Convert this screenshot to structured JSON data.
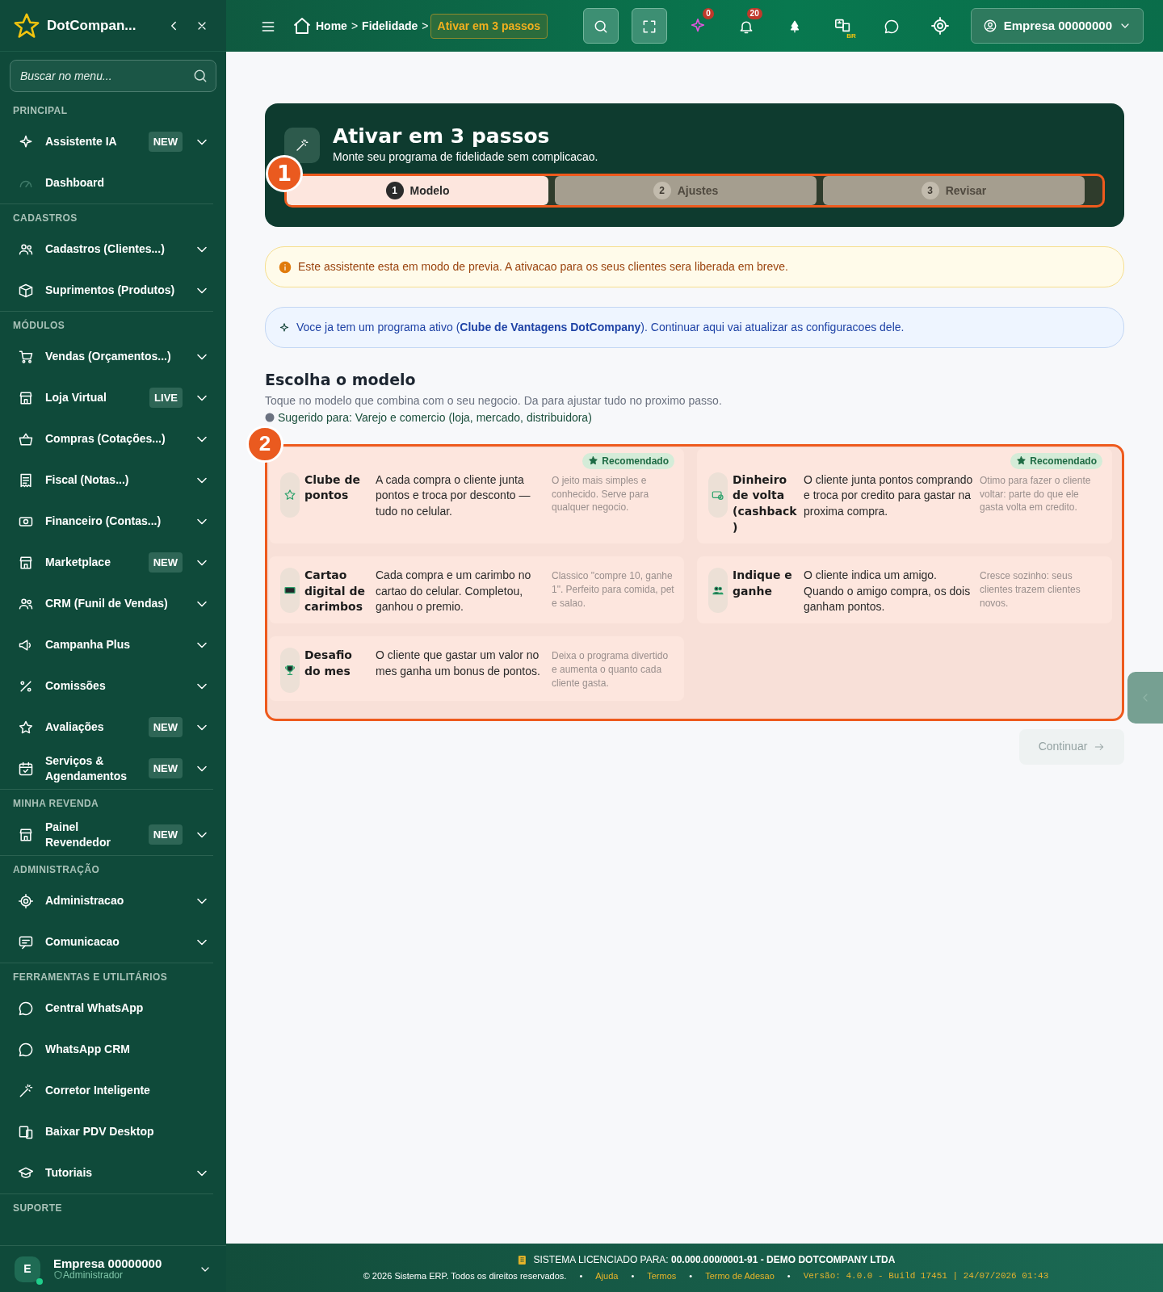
{
  "sidebar": {
    "brand": "DotCompan...",
    "search": {
      "placeholder": "Buscar no menu..."
    },
    "sections": [
      {
        "title": "PRINCIPAL",
        "items": [
          {
            "label": "Assistente IA",
            "badge": "NEW",
            "expandable": true
          },
          {
            "label": "Dashboard",
            "expandable": false
          }
        ]
      },
      {
        "title": "CADASTROS",
        "items": [
          {
            "label": "Cadastros (Clientes...)",
            "expandable": true
          },
          {
            "label": "Suprimentos (Produtos)",
            "expandable": true
          }
        ]
      },
      {
        "title": "MÓDULOS",
        "items": [
          {
            "label": "Vendas (Orçamentos...)",
            "expandable": true
          },
          {
            "label": "Loja Virtual",
            "badge": "LIVE",
            "expandable": true
          },
          {
            "label": "Compras (Cotações...)",
            "expandable": true
          },
          {
            "label": "Fiscal (Notas...)",
            "expandable": true
          },
          {
            "label": "Financeiro (Contas...)",
            "expandable": true
          },
          {
            "label": "Marketplace",
            "badge": "NEW",
            "expandable": true
          },
          {
            "label": "CRM (Funil de Vendas)",
            "expandable": true
          },
          {
            "label": "Campanha Plus",
            "expandable": true
          },
          {
            "label": "Comissões",
            "expandable": true
          },
          {
            "label": "Avaliações",
            "badge": "NEW",
            "expandable": true
          },
          {
            "label": "Serviços & Agendamentos",
            "badge": "NEW",
            "expandable": true
          }
        ]
      },
      {
        "title": "MINHA REVENDA",
        "items": [
          {
            "label": "Painel Revendedor",
            "badge": "NEW",
            "expandable": true
          }
        ]
      },
      {
        "title": "ADMINISTRAÇÃO",
        "items": [
          {
            "label": "Administracao",
            "expandable": true
          },
          {
            "label": "Comunicacao",
            "expandable": true
          }
        ]
      },
      {
        "title": "FERRAMENTAS E UTILITÁRIOS",
        "items": [
          {
            "label": "Central WhatsApp",
            "expandable": false
          },
          {
            "label": "WhatsApp CRM",
            "expandable": false
          },
          {
            "label": "Corretor Inteligente",
            "expandable": false
          },
          {
            "label": "Baixar PDV Desktop",
            "expandable": false
          },
          {
            "label": "Tutoriais",
            "expandable": true
          }
        ]
      },
      {
        "title": "SUPORTE"
      }
    ],
    "user": {
      "initial": "E",
      "name": "Empresa 00000000",
      "role": "Administrador",
      "online": true
    }
  },
  "topbar": {
    "separator": ">",
    "breadcrumb": [
      {
        "label": "Home",
        "current": false
      },
      {
        "label": "Fidelidade",
        "current": false
      },
      {
        "label": "Ativar em 3 passos",
        "current": true
      }
    ],
    "sparkle_badge": "0",
    "bell_badge": "20",
    "language": "BR",
    "account": "Empresa 00000000"
  },
  "wizard": {
    "title": "Ativar em 3 passos",
    "subtitle": "Monte seu programa de fidelidade sem complicacao.",
    "steps": [
      {
        "number": "1",
        "label": "Modelo",
        "selected": true
      },
      {
        "number": "2",
        "label": "Ajustes",
        "selected": false
      },
      {
        "number": "3",
        "label": "Revisar",
        "selected": false
      }
    ]
  },
  "alerts": [
    {
      "kind": "warning",
      "text": "Este assistente esta em modo de previa. A ativacao para os seus clientes sera liberada em breve."
    },
    {
      "kind": "info",
      "text": "Voce ja tem um programa ativo (**Clube de Vantagens DotCompany**). Continuar aqui vai atualizar as configuracoes dele."
    }
  ],
  "section": {
    "title": "Escolha o modelo",
    "subtitle": "Toque no modelo que combina com o seu negocio. Da para ajustar tudo no proximo passo.",
    "suggestion": "Sugerido para: Varejo e comercio (loja, mercado, distribuidora)"
  },
  "models": [
    {
      "title": "Clube de pontos",
      "description": "A cada compra o cliente junta pontos e troca por desconto — tudo no celular.",
      "hint": "O jeito mais simples e conhecido. Serve para qualquer negocio.",
      "badge": "Recomendado"
    },
    {
      "title": "Dinheiro de volta (cashback)",
      "description": "O cliente junta pontos comprando e troca por credito para gastar na proxima compra.",
      "hint": "Otimo para fazer o cliente voltar: parte do que ele gasta volta em credito.",
      "badge": "Recomendado"
    },
    {
      "title": "Cartao digital de carimbos",
      "description": "Cada compra e um carimbo no cartao do celular. Completou, ganhou o premio.",
      "hint": "Classico \"compre 10, ganhe 1\". Perfeito para comida, pet e salao."
    },
    {
      "title": "Indique e ganhe",
      "description": "O cliente indica um amigo. Quando o amigo compra, os dois ganham pontos.",
      "hint": "Cresce sozinho: seus clientes trazem clientes novos."
    },
    {
      "title": "Desafio do mes",
      "description": "O cliente que gastar um valor no mes ganha um bonus de pontos.",
      "hint": "Deixa o programa divertido e aumenta o quanto cada cliente gasta."
    }
  ],
  "continue_button": {
    "label": "Continuar",
    "disabled": true
  },
  "tour_markers": [
    "1",
    "2"
  ],
  "footer": {
    "separator": "•",
    "license_label": "SISTEMA LICENCIADO PARA:",
    "license_value": "00.000.000/0001-91 - DEMO DOTCOMPANY LTDA",
    "copyright": "© 2026 Sistema ERP. Todos os direitos reservados.",
    "links": [
      "Ajuda",
      "Termos",
      "Termo de Adesao"
    ],
    "version": "Versão: 4.0.0 - Build 17451 | 24/07/2026 01:43"
  }
}
